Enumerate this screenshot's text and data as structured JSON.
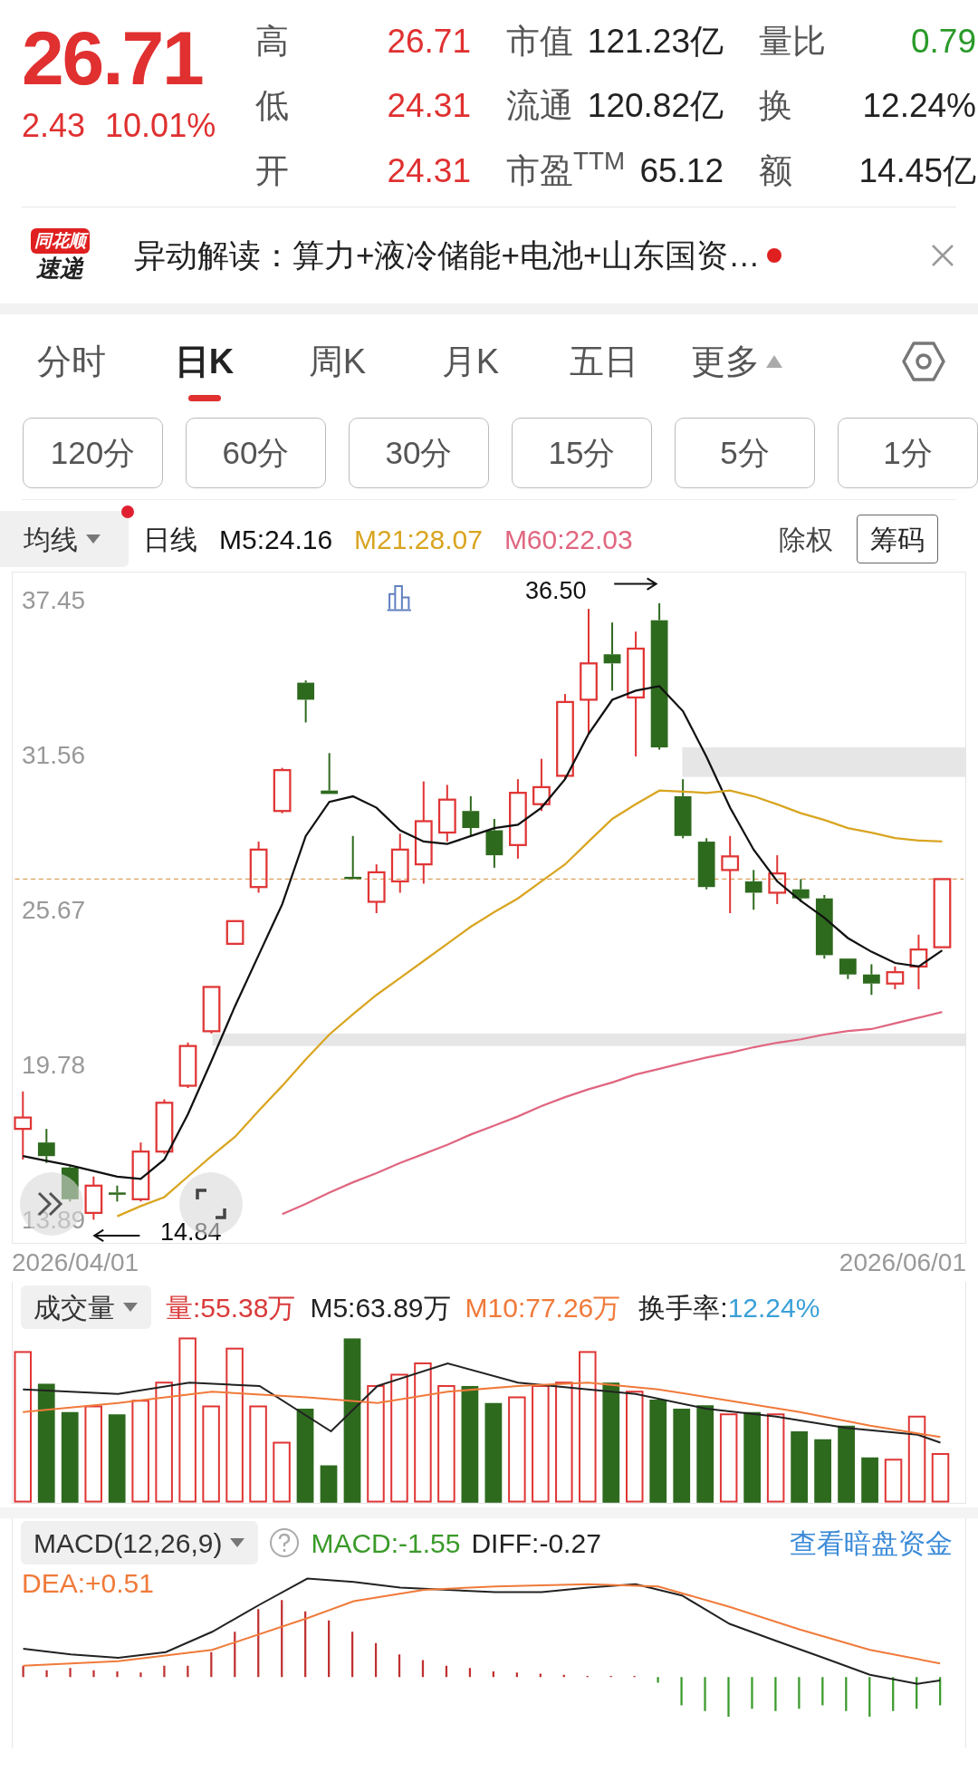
{
  "quote": {
    "price": "26.71",
    "change": "2.43",
    "change_pct": "10.01%"
  },
  "stats": [
    {
      "label": "高",
      "value": "26.71",
      "kind": "up"
    },
    {
      "label": "市值",
      "value": "121.23亿",
      "kind": "neutral"
    },
    {
      "label": "量比",
      "value": "0.79",
      "kind": "down"
    },
    {
      "label": "低",
      "value": "24.31",
      "kind": "up"
    },
    {
      "label": "流通",
      "value": "120.82亿",
      "kind": "neutral"
    },
    {
      "label": "换",
      "value": "12.24%",
      "kind": "neutral"
    },
    {
      "label": "开",
      "value": "24.31",
      "kind": "up"
    },
    {
      "label": "市盈$^{TTM}$",
      "value": "65.12",
      "kind": "neutral"
    },
    {
      "label": "额",
      "value": "14.45亿",
      "kind": "neutral"
    }
  ],
  "news": {
    "logo_top": "同花顺",
    "logo_bottom": "速递",
    "text": "异动解读：算力+液冷储能+电池+山东国资…",
    "unread": true
  },
  "tabs": [
    {
      "label": "分时",
      "selected": false
    },
    {
      "label": "日K",
      "selected": true
    },
    {
      "label": "周K",
      "selected": false
    },
    {
      "label": "月K",
      "selected": false
    },
    {
      "label": "五日",
      "selected": false
    },
    {
      "label": "更多",
      "selected": false
    }
  ],
  "intervals": [
    {
      "label": "120分",
      "selected": false
    },
    {
      "label": "60分",
      "selected": false
    },
    {
      "label": "30分",
      "selected": false
    },
    {
      "label": "15分",
      "selected": false
    },
    {
      "label": "5分",
      "selected": false
    },
    {
      "label": "1分",
      "selected": false
    }
  ],
  "kline": {
    "indicator": "均线",
    "indicator_unread": true,
    "period": "日线",
    "legend": [
      {
        "text": "M5:24.16",
        "color": "#111111"
      },
      {
        "text": "M21:28.07",
        "color": "#d9a521"
      },
      {
        "text": "M60:22.03",
        "color": "#e06680"
      }
    ],
    "adjust": "除权",
    "chips_button": "筹码",
    "chart_data": {
      "type": "line",
      "ylim": [
        12.97,
        38.53
      ],
      "yticks": [
        {
          "value": 37.45,
          "label": "37.45"
        },
        {
          "value": 31.56,
          "label": "31.56"
        },
        {
          "value": 25.67,
          "label": "25.67"
        },
        {
          "value": 19.78,
          "label": "19.78"
        },
        {
          "value": 13.89,
          "label": "13.89"
        }
      ],
      "series": [
        {
          "color": "#111111",
          "values": [
            16.34,
            16.16,
            15.99,
            15.77,
            15.56,
            15.47,
            16.21,
            17.93,
            19.96,
            22.04,
            23.98,
            25.92,
            28.51,
            29.81,
            30.02,
            29.59,
            28.73,
            28.3,
            28.21,
            28.51,
            28.81,
            28.94,
            29.59,
            30.67,
            32.4,
            33.69,
            34.04,
            34.21,
            33.26,
            31.53,
            29.59,
            27.99,
            26.79,
            26.05,
            25.4,
            24.63,
            24.11,
            23.68,
            23.55,
            24.16
          ]
        },
        {
          "color": "#d9a521",
          "values": [
            null,
            null,
            null,
            null,
            14.05,
            14.44,
            14.78,
            15.56,
            16.34,
            17.07,
            18.06,
            19.01,
            20.01,
            20.96,
            21.73,
            22.47,
            23.11,
            23.76,
            24.41,
            25.06,
            25.62,
            26.14,
            26.79,
            27.43,
            28.3,
            29.16,
            29.72,
            30.24,
            30.2,
            30.15,
            30.24,
            30.02,
            29.72,
            29.38,
            29.12,
            28.81,
            28.64,
            28.43,
            28.34,
            28.3
          ]
        },
        {
          "color": "#e06680",
          "values": [
            null,
            null,
            null,
            null,
            null,
            null,
            null,
            null,
            null,
            null,
            null,
            14.13,
            14.52,
            14.95,
            15.34,
            15.69,
            16.08,
            16.42,
            16.77,
            17.16,
            17.5,
            17.85,
            18.24,
            18.58,
            18.88,
            19.14,
            19.44,
            19.66,
            19.88,
            20.09,
            20.27,
            20.48,
            20.65,
            20.78,
            20.96,
            21.09,
            21.17,
            21.39,
            21.6,
            21.82
          ]
        }
      ]
    },
    "high_mark": "36.50",
    "low_mark": "14.84",
    "start_date": "2026/04/01",
    "end_date": "2026/06/01"
  },
  "volume": {
    "title": "成交量",
    "legend": [
      {
        "text": "量:55.38万",
        "color": "#d93a3a"
      },
      {
        "text": "M5:63.89万",
        "color": "#222222"
      },
      {
        "text": "M10:77.26万",
        "color": "#f07a3a"
      }
    ],
    "turnover_label": "换手率:",
    "turnover_value": "12.24%"
  },
  "macd": {
    "title": "MACD(12,26,9)",
    "legend": [
      {
        "text": "MACD:-1.55",
        "color": "#3a9a2a"
      },
      {
        "text": "DIFF:-0.27",
        "color": "#222222"
      },
      {
        "text": "DEA:+0.51",
        "color": "#f07a3a"
      }
    ],
    "link": "查看暗盘资金"
  }
}
